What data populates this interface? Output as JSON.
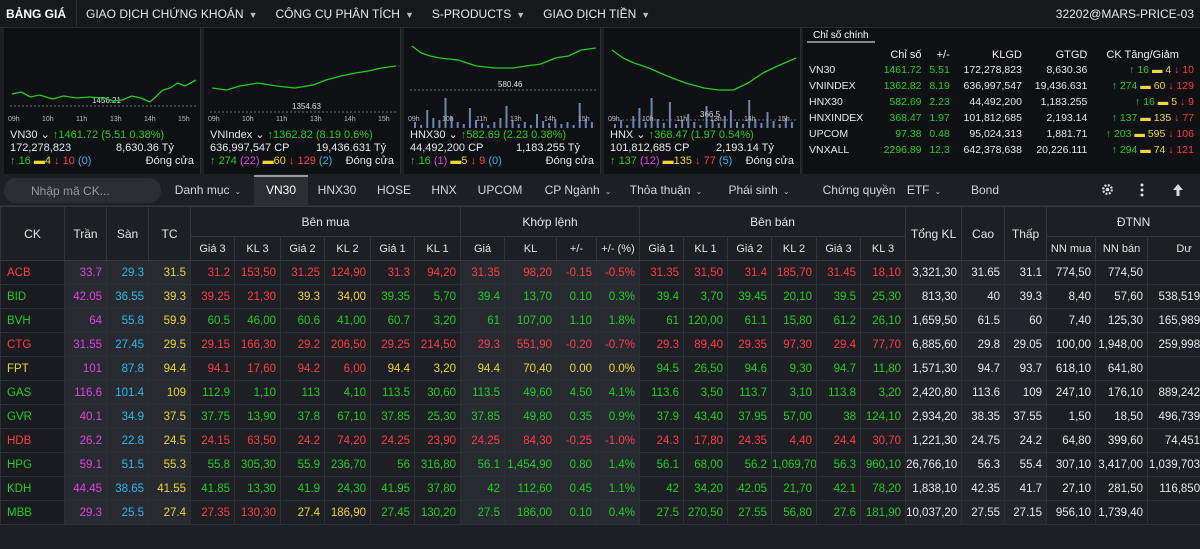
{
  "nav": {
    "brand": "BẢNG GIÁ",
    "items": [
      "GIAO DỊCH CHỨNG KHOÁN",
      "CÔNG CỤ PHÂN TÍCH",
      "S-PRODUCTS",
      "GIAO DỊCH TIỀN"
    ],
    "account": "32202@MARS-PRICE-03"
  },
  "charts": [
    {
      "name": "VN30",
      "arrow": "↑",
      "index": "1461.72",
      "change": "(5.51  0.38%)",
      "volume": "172,278,823",
      "value": "8,630.36 Tỷ",
      "refline": "1456.21",
      "up": "16",
      "ref": "4",
      "down": "10",
      "floor": "(0)",
      "status": "Đóng cửa",
      "times": [
        "09h",
        "10h",
        "11h",
        "13h",
        "14h",
        "15h"
      ],
      "price": [
        [
          0,
          0.66
        ],
        [
          0.05,
          0.64
        ],
        [
          0.1,
          0.69
        ],
        [
          0.15,
          0.67
        ],
        [
          0.22,
          0.71
        ],
        [
          0.28,
          0.68
        ],
        [
          0.35,
          0.7
        ],
        [
          0.42,
          0.69
        ],
        [
          0.5,
          0.7
        ],
        [
          0.55,
          0.73
        ],
        [
          0.6,
          0.72
        ],
        [
          0.65,
          0.68
        ],
        [
          0.7,
          0.7
        ],
        [
          0.75,
          0.74
        ],
        [
          0.78,
          0.69
        ],
        [
          0.82,
          0.62
        ],
        [
          0.86,
          0.6
        ],
        [
          0.9,
          0.55
        ],
        [
          0.94,
          0.58
        ],
        [
          1,
          0.52
        ]
      ]
    },
    {
      "name": "VNIndex",
      "arrow": "↑",
      "index": "1362.82",
      "change": "(8.19  0.6%)",
      "volume": "636,997,547 CP",
      "value": "19,436.631 Tỷ",
      "refline": "1354.63",
      "up": "274",
      "ceil": "(22)",
      "ref": "60",
      "down": "129",
      "floor": "(2)",
      "status": "Đóng cửa",
      "times": [
        "09h",
        "10h",
        "11h",
        "13h",
        "14h",
        "15h"
      ],
      "price": [
        [
          0,
          0.6
        ],
        [
          0.08,
          0.62
        ],
        [
          0.15,
          0.58
        ],
        [
          0.25,
          0.55
        ],
        [
          0.35,
          0.58
        ],
        [
          0.45,
          0.6
        ],
        [
          0.55,
          0.57
        ],
        [
          0.62,
          0.52
        ],
        [
          0.7,
          0.48
        ],
        [
          0.78,
          0.45
        ],
        [
          0.85,
          0.43
        ],
        [
          0.92,
          0.4
        ],
        [
          1,
          0.38
        ]
      ]
    },
    {
      "name": "HNX30",
      "arrow": "↑",
      "index": "582.69",
      "change": "(2.23  0.38%)",
      "volume": "44,492,200 CP",
      "value": "1,183.255 Tỷ",
      "refline": "580.46",
      "up": "16",
      "ceil": "(1)",
      "ref": "5",
      "down": "9",
      "floor": "(0)",
      "status": "Đóng cửa",
      "times": [
        "09h",
        "10h",
        "11h",
        "13h",
        "14h",
        "15h"
      ],
      "price": [
        [
          0,
          0.18
        ],
        [
          0.05,
          0.25
        ],
        [
          0.1,
          0.28
        ],
        [
          0.15,
          0.3
        ],
        [
          0.25,
          0.32
        ],
        [
          0.35,
          0.38
        ],
        [
          0.45,
          0.4
        ],
        [
          0.55,
          0.4
        ],
        [
          0.62,
          0.38
        ],
        [
          0.7,
          0.36
        ],
        [
          0.78,
          0.3
        ],
        [
          0.85,
          0.28
        ],
        [
          0.92,
          0.22
        ],
        [
          1,
          0.2
        ]
      ]
    },
    {
      "name": "HNX",
      "arrow": "↑",
      "index": "368.47",
      "change": "(1.97  0.54%)",
      "volume": "101,812,685 CP",
      "value": "2,193.14 Tỷ",
      "refline": "366.5",
      "up": "137",
      "ceil": "(12)",
      "ref": "135",
      "down": "77",
      "floor": "(5)",
      "status": "Đóng cửa",
      "times": [
        "09h",
        "10h",
        "11h",
        "13h",
        "14h",
        "15h"
      ],
      "price": [
        [
          0,
          0.22
        ],
        [
          0.06,
          0.3
        ],
        [
          0.12,
          0.35
        ],
        [
          0.2,
          0.4
        ],
        [
          0.3,
          0.48
        ],
        [
          0.4,
          0.55
        ],
        [
          0.5,
          0.6
        ],
        [
          0.58,
          0.62
        ],
        [
          0.66,
          0.62
        ],
        [
          0.74,
          0.55
        ],
        [
          0.82,
          0.45
        ],
        [
          0.9,
          0.38
        ],
        [
          1,
          0.3
        ]
      ]
    }
  ],
  "index_table": {
    "tab": "Chỉ số chính",
    "headers": [
      "",
      "Chỉ số",
      "+/-",
      "KLGD",
      "GTGD",
      "CK Tăng/Giảm"
    ],
    "rows": [
      {
        "name": "VN30",
        "index": "1461.72",
        "chg": "5.51",
        "klgd": "172,278,823",
        "gtgd": "8,630.36",
        "up": "16",
        "ref": "4",
        "down": "10"
      },
      {
        "name": "VNINDEX",
        "index": "1362.82",
        "chg": "8.19",
        "klgd": "636,997,547",
        "gtgd": "19,436.631",
        "up": "274",
        "ref": "60",
        "down": "129"
      },
      {
        "name": "HNX30",
        "index": "582.69",
        "chg": "2.23",
        "klgd": "44,492,200",
        "gtgd": "1,183.255",
        "up": "16",
        "ref": "5",
        "down": "9"
      },
      {
        "name": "HNXINDEX",
        "index": "368.47",
        "chg": "1.97",
        "klgd": "101,812,685",
        "gtgd": "2,193.14",
        "up": "137",
        "ref": "135",
        "down": "77"
      },
      {
        "name": "UPCOM",
        "index": "97.38",
        "chg": "0.48",
        "klgd": "95,024,313",
        "gtgd": "1,881.71",
        "up": "203",
        "ref": "595",
        "down": "106"
      },
      {
        "name": "VNXALL",
        "index": "2296.89",
        "chg": "12.3",
        "klgd": "642,378,638",
        "gtgd": "20,226.111",
        "up": "294",
        "ref": "74",
        "down": "121"
      }
    ]
  },
  "toolbar": {
    "search_placeholder": "Nhập mã CK...",
    "tabs": [
      "Danh mục",
      "VN30",
      "HNX30",
      "HOSE",
      "HNX",
      "UPCOM",
      "CP Ngành",
      "Thỏa thuận",
      "Phái sinh",
      "Chứng quyền",
      "ETF",
      "Bond"
    ]
  },
  "grid": {
    "headers": {
      "ck": "CK",
      "tran": "Trần",
      "san": "Sàn",
      "tc": "TC",
      "buy": "Bên mua",
      "match": "Khớp lệnh",
      "sell": "Bên bán",
      "total": "Tổng KL",
      "high": "Cao",
      "low": "Thấp",
      "foreign": "ĐTNN"
    },
    "sub": {
      "buy": [
        "Giá 3",
        "KL 3",
        "Giá 2",
        "KL 2",
        "Giá 1",
        "KL 1"
      ],
      "match": [
        "Giá",
        "KL",
        "+/-",
        "+/- (%)"
      ],
      "sell": [
        "Giá 1",
        "KL 1",
        "Giá 2",
        "KL 2",
        "Giá 3",
        "KL 3"
      ],
      "foreign": [
        "NN mua",
        "NN bán",
        "Dư"
      ]
    },
    "rows": [
      {
        "c": "dn",
        "v": [
          "ACB",
          "33.7",
          "29.3",
          "31.5",
          "31.2",
          "153,50",
          "31.25",
          "124,90",
          "31.3",
          "94,20",
          "31.35",
          "98,20",
          "-0.15",
          "-0.5%",
          "31.35",
          "31,50",
          "31.4",
          "185,70",
          "31.45",
          "18,10",
          "3,321,30",
          "31.65",
          "31.1",
          "774,50",
          "774,50",
          ""
        ],
        "k": [
          "dn",
          "ceil",
          "flo",
          "ref",
          "dn",
          "dn",
          "dn",
          "dn",
          "dn",
          "dn",
          "dn",
          "dn",
          "dn",
          "dn",
          "dn",
          "dn",
          "dn",
          "dn",
          "dn",
          "dn",
          "w",
          "up",
          "dn",
          "w",
          "w",
          "w"
        ]
      },
      {
        "c": "up",
        "v": [
          "BID",
          "42.05",
          "36.55",
          "39.3",
          "39.25",
          "21,30",
          "39.3",
          "34,00",
          "39.35",
          "5,70",
          "39.4",
          "13,70",
          "0.10",
          "0.3%",
          "39.4",
          "3,70",
          "39.45",
          "20,10",
          "39.5",
          "25,30",
          "813,30",
          "40",
          "39.3",
          "8,40",
          "57,60",
          "538,519,06"
        ],
        "k": [
          "up",
          "ceil",
          "flo",
          "ref",
          "dn",
          "dn",
          "ref",
          "ref",
          "up",
          "up",
          "up",
          "up",
          "up",
          "up",
          "up",
          "up",
          "up",
          "up",
          "up",
          "up",
          "w",
          "up",
          "ref",
          "w",
          "w",
          "w"
        ]
      },
      {
        "c": "up",
        "v": [
          "BVH",
          "64",
          "55.8",
          "59.9",
          "60.5",
          "46,00",
          "60.6",
          "41,00",
          "60.7",
          "3,20",
          "61",
          "107,00",
          "1.10",
          "1.8%",
          "61",
          "120,00",
          "61.1",
          "15,80",
          "61.2",
          "26,10",
          "1,659,50",
          "61.5",
          "60",
          "7,40",
          "125,30",
          "165,989,19"
        ],
        "k": [
          "up",
          "ceil",
          "flo",
          "ref",
          "up",
          "up",
          "up",
          "up",
          "up",
          "up",
          "up",
          "up",
          "up",
          "up",
          "up",
          "up",
          "up",
          "up",
          "up",
          "up",
          "w",
          "up",
          "up",
          "w",
          "w",
          "w"
        ]
      },
      {
        "c": "dn",
        "v": [
          "CTG",
          "31.55",
          "27.45",
          "29.5",
          "29.15",
          "166,30",
          "29.2",
          "206,50",
          "29.25",
          "214,50",
          "29.3",
          "551,90",
          "-0.20",
          "-0.7%",
          "29.3",
          "89,40",
          "29.35",
          "97,30",
          "29.4",
          "77,70",
          "6,885,60",
          "29.8",
          "29.05",
          "100,00",
          "1,948,00",
          "259,998,59"
        ],
        "k": [
          "dn",
          "ceil",
          "flo",
          "ref",
          "dn",
          "dn",
          "dn",
          "dn",
          "dn",
          "dn",
          "dn",
          "dn",
          "dn",
          "dn",
          "dn",
          "dn",
          "dn",
          "dn",
          "dn",
          "dn",
          "w",
          "up",
          "dn",
          "w",
          "w",
          "w"
        ]
      },
      {
        "c": "ref",
        "v": [
          "FPT",
          "101",
          "87.8",
          "94.4",
          "94.1",
          "17,60",
          "94.2",
          "6,00",
          "94.4",
          "3,20",
          "94.4",
          "70,40",
          "0.00",
          "0.0%",
          "94.5",
          "26,50",
          "94.6",
          "9,30",
          "94.7",
          "11,80",
          "1,571,30",
          "94.7",
          "93.7",
          "618,10",
          "641,80",
          "8"
        ],
        "k": [
          "ref",
          "ceil",
          "flo",
          "ref",
          "dn",
          "dn",
          "dn",
          "dn",
          "ref",
          "ref",
          "ref",
          "ref",
          "ref",
          "ref",
          "up",
          "up",
          "up",
          "up",
          "up",
          "up",
          "w",
          "up",
          "dn",
          "w",
          "w",
          "w"
        ]
      },
      {
        "c": "up",
        "v": [
          "GAS",
          "116.6",
          "101.4",
          "109",
          "112.9",
          "1,10",
          "113",
          "4,10",
          "113.5",
          "30,60",
          "113.5",
          "49,60",
          "4.50",
          "4.1%",
          "113.6",
          "3,50",
          "113.7",
          "3,10",
          "113.8",
          "3,20",
          "2,420,80",
          "113.6",
          "109",
          "247,10",
          "176,10",
          "889,242,62"
        ],
        "k": [
          "up",
          "ceil",
          "flo",
          "ref",
          "up",
          "up",
          "up",
          "up",
          "up",
          "up",
          "up",
          "up",
          "up",
          "up",
          "up",
          "up",
          "up",
          "up",
          "up",
          "up",
          "w",
          "up",
          "ref",
          "w",
          "w",
          "w"
        ]
      },
      {
        "c": "up",
        "v": [
          "GVR",
          "40.1",
          "34.9",
          "37.5",
          "37.75",
          "13,90",
          "37.8",
          "67,10",
          "37.85",
          "25,30",
          "37.85",
          "49,80",
          "0.35",
          "0.9%",
          "37.9",
          "43,40",
          "37.95",
          "57,00",
          "38",
          "124,10",
          "2,934,20",
          "38.35",
          "37.55",
          "1,50",
          "18,50",
          "496,739,50"
        ],
        "k": [
          "up",
          "ceil",
          "flo",
          "ref",
          "up",
          "up",
          "up",
          "up",
          "up",
          "up",
          "up",
          "up",
          "up",
          "up",
          "up",
          "up",
          "up",
          "up",
          "up",
          "up",
          "w",
          "up",
          "up",
          "w",
          "w",
          "w"
        ]
      },
      {
        "c": "dn",
        "v": [
          "HDB",
          "26.2",
          "22.8",
          "24.5",
          "24.15",
          "63,50",
          "24.2",
          "74,20",
          "24.25",
          "23,90",
          "24.25",
          "84,30",
          "-0.25",
          "-1.0%",
          "24.3",
          "17,80",
          "24.35",
          "4,40",
          "24.4",
          "30,70",
          "1,221,30",
          "24.75",
          "24.2",
          "64,80",
          "399,60",
          "74,451,78"
        ],
        "k": [
          "dn",
          "ceil",
          "flo",
          "ref",
          "dn",
          "dn",
          "dn",
          "dn",
          "dn",
          "dn",
          "dn",
          "dn",
          "dn",
          "dn",
          "dn",
          "dn",
          "dn",
          "dn",
          "dn",
          "dn",
          "w",
          "up",
          "dn",
          "w",
          "w",
          "w"
        ]
      },
      {
        "c": "up",
        "v": [
          "HPG",
          "59.1",
          "51.5",
          "55.3",
          "55.8",
          "305,30",
          "55.9",
          "236,70",
          "56",
          "316,80",
          "56.1",
          "1,454,90",
          "0.80",
          "1.4%",
          "56.1",
          "68,00",
          "56.2",
          "1,069,70",
          "56.3",
          "960,10",
          "26,766,10",
          "56.3",
          "55.4",
          "307,10",
          "3,417,00",
          "1,039,703,50"
        ],
        "k": [
          "up",
          "ceil",
          "flo",
          "ref",
          "up",
          "up",
          "up",
          "up",
          "up",
          "up",
          "up",
          "up",
          "up",
          "up",
          "up",
          "up",
          "up",
          "up",
          "up",
          "up",
          "w",
          "up",
          "up",
          "w",
          "w",
          "w"
        ]
      },
      {
        "c": "up",
        "v": [
          "KDH",
          "44.45",
          "38.65",
          "41.55",
          "41.85",
          "13,30",
          "41.9",
          "24,30",
          "41.95",
          "37,80",
          "42",
          "112,60",
          "0.45",
          "1.1%",
          "42",
          "34,20",
          "42.05",
          "21,70",
          "42.1",
          "78,20",
          "1,838,10",
          "42.35",
          "41.7",
          "27,10",
          "281,50",
          "116,850,34"
        ],
        "k": [
          "up",
          "ceil",
          "flo",
          "ref",
          "up",
          "up",
          "up",
          "up",
          "up",
          "up",
          "up",
          "up",
          "up",
          "up",
          "up",
          "up",
          "up",
          "up",
          "up",
          "up",
          "w",
          "up",
          "up",
          "w",
          "w",
          "w"
        ]
      },
      {
        "c": "up",
        "v": [
          "MBB",
          "29.3",
          "25.5",
          "27.4",
          "27.35",
          "130,30",
          "27.4",
          "186,90",
          "27.45",
          "130,20",
          "27.5",
          "186,00",
          "0.10",
          "0.4%",
          "27.5",
          "270,50",
          "27.55",
          "56,80",
          "27.6",
          "181,90",
          "10,037,20",
          "27.55",
          "27.15",
          "956,10",
          "1,739,40",
          "3"
        ],
        "k": [
          "up",
          "ceil",
          "flo",
          "ref",
          "dn",
          "dn",
          "ref",
          "ref",
          "up",
          "up",
          "up",
          "up",
          "up",
          "up",
          "up",
          "up",
          "up",
          "up",
          "up",
          "up",
          "w",
          "up",
          "dn",
          "w",
          "w",
          "w"
        ]
      }
    ]
  }
}
